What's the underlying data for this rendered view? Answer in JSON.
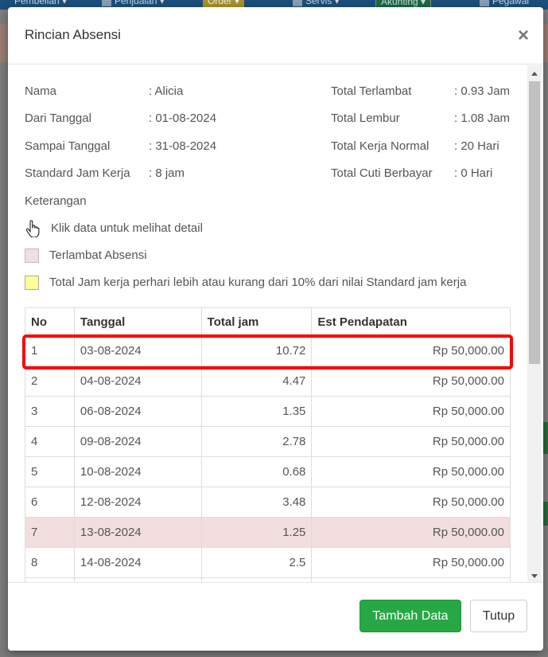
{
  "background": {
    "nav_items": [
      "Pembelian",
      "Penjualan",
      "Order",
      "Servis",
      "Akunting",
      "Pegawai"
    ]
  },
  "modal": {
    "title": "Rincian Absensi",
    "close_symbol": "×"
  },
  "info_left": [
    {
      "label": "Nama",
      "value": ": Alicia"
    },
    {
      "label": "Dari Tanggal",
      "value": ": 01-08-2024"
    },
    {
      "label": "Sampai Tanggal",
      "value": ": 31-08-2024"
    },
    {
      "label": "Standard Jam Kerja",
      "value": ": 8 jam"
    },
    {
      "label": "Keterangan",
      "value": ""
    }
  ],
  "info_right": [
    {
      "label": "Total Terlambat",
      "value": ": 0.93 Jam"
    },
    {
      "label": "Total Lembur",
      "value": ": 1.08 Jam"
    },
    {
      "label": "Total Kerja Normal",
      "value": ": 20 Hari"
    },
    {
      "label": "Total Cuti Berbayar",
      "value": ": 0 Hari"
    }
  ],
  "legend": {
    "click_hint": "Klik data untuk melihat detail",
    "late": "Terlambat Absensi",
    "deviation": "Total Jam kerja perhari lebih atau kurang dari 10% dari nilai Standard jam kerja"
  },
  "table": {
    "headers": [
      "No",
      "Tanggal",
      "Total jam",
      "Est Pendapatan"
    ],
    "rows": [
      {
        "no": "1",
        "date": "03-08-2024",
        "hours": "10.72",
        "income": "Rp 50,000.00",
        "late": false
      },
      {
        "no": "2",
        "date": "04-08-2024",
        "hours": "4.47",
        "income": "Rp 50,000.00",
        "late": false
      },
      {
        "no": "3",
        "date": "06-08-2024",
        "hours": "1.35",
        "income": "Rp 50,000.00",
        "late": false
      },
      {
        "no": "4",
        "date": "09-08-2024",
        "hours": "2.78",
        "income": "Rp 50,000.00",
        "late": false
      },
      {
        "no": "5",
        "date": "10-08-2024",
        "hours": "0.68",
        "income": "Rp 50,000.00",
        "late": false
      },
      {
        "no": "6",
        "date": "12-08-2024",
        "hours": "3.48",
        "income": "Rp 50,000.00",
        "late": false
      },
      {
        "no": "7",
        "date": "13-08-2024",
        "hours": "1.25",
        "income": "Rp 50,000.00",
        "late": true
      },
      {
        "no": "8",
        "date": "14-08-2024",
        "hours": "2.5",
        "income": "Rp 50,000.00",
        "late": false
      },
      {
        "no": "",
        "date": "",
        "hours": "",
        "income": "",
        "late": false
      }
    ]
  },
  "footer": {
    "add_label": "Tambah Data",
    "close_label": "Tutup"
  },
  "colors": {
    "primary": "#28a745",
    "late_row": "#f2dede",
    "deviation_swatch": "#ffff99",
    "highlight": "#ff0000"
  }
}
